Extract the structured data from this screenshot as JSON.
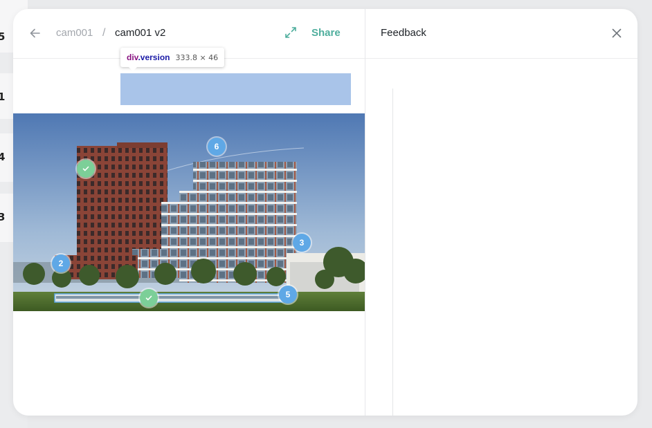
{
  "background_list": {
    "row_numbers": [
      "5",
      "1",
      "4",
      "3"
    ]
  },
  "breadcrumb": {
    "parent": "cam001",
    "separator": "/",
    "current": "cam001 v2"
  },
  "header": {
    "share_label": "Share"
  },
  "feedback_panel": {
    "title": "Feedback"
  },
  "inspector_tooltip": {
    "tag": "div",
    "class_name": ".version",
    "dimensions": "333.8 × 46"
  },
  "markers": [
    {
      "label": "6",
      "status": "open"
    },
    {
      "label": "",
      "status": "resolved"
    },
    {
      "label": "3",
      "status": "open"
    },
    {
      "label": "2",
      "status": "open"
    },
    {
      "label": "",
      "status": "resolved"
    },
    {
      "label": "5",
      "status": "open"
    }
  ],
  "colors": {
    "accent": "#4fae9d",
    "marker_open": "#5fa8e6",
    "marker_resolved": "#7ccf98",
    "highlight": "#6f9ddb"
  }
}
